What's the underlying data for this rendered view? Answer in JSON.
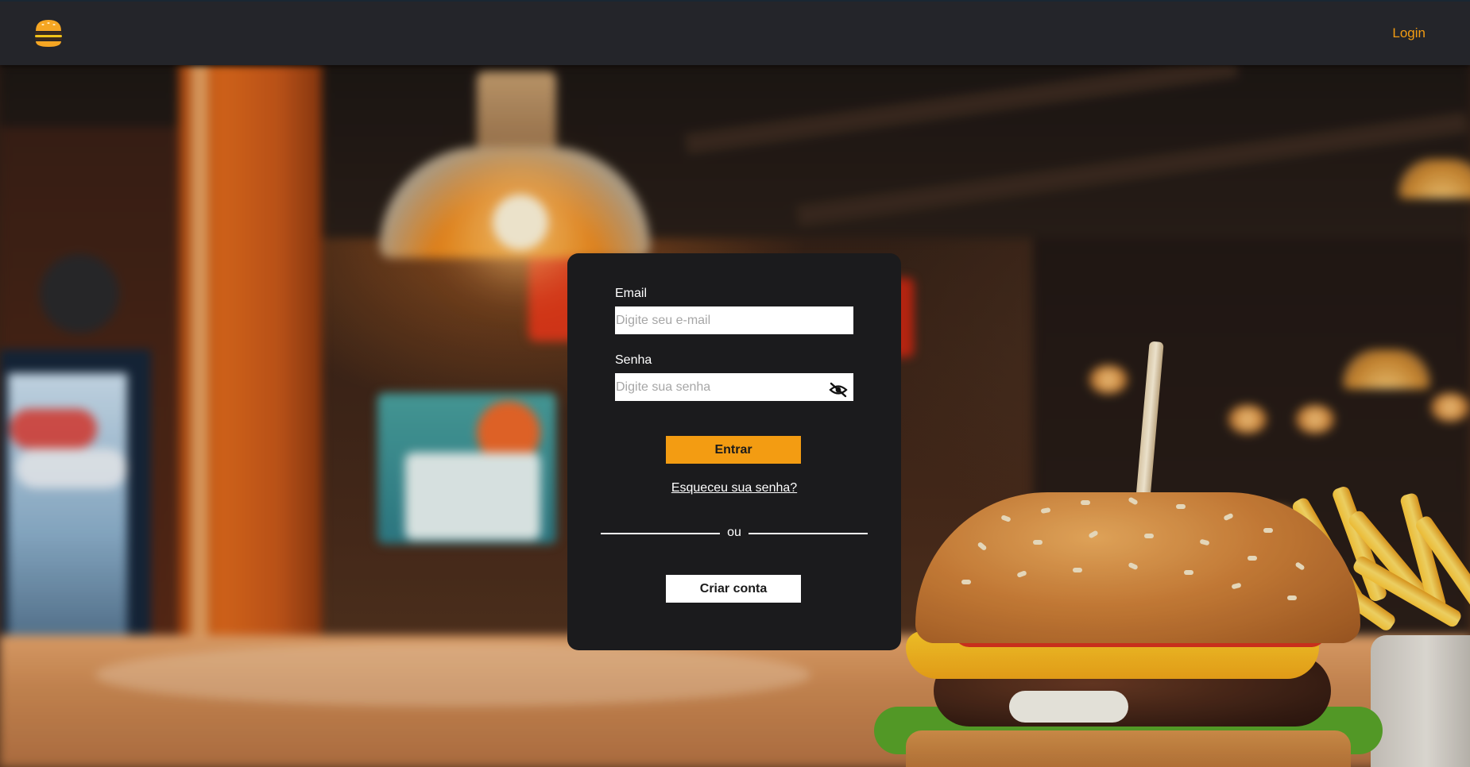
{
  "navbar": {
    "logo_icon": "burger-logo-icon",
    "login_label": "Login",
    "accent_color": "#f39c12",
    "background_color": "#24252a"
  },
  "login_form": {
    "email": {
      "label": "Email",
      "placeholder": "Digite seu e-mail",
      "value": ""
    },
    "password": {
      "label": "Senha",
      "placeholder": "Digite sua senha",
      "value": "",
      "toggle_icon": "eye-slash-icon"
    },
    "submit_label": "Entrar",
    "forgot_password_label": "Esqueceu sua senha?",
    "divider_label": "ou",
    "create_account_label": "Criar conta",
    "card_color": "#1b1b1d",
    "primary_button_color": "#f39c12"
  },
  "background": {
    "description_icon": "restaurant-burger-background-image"
  }
}
